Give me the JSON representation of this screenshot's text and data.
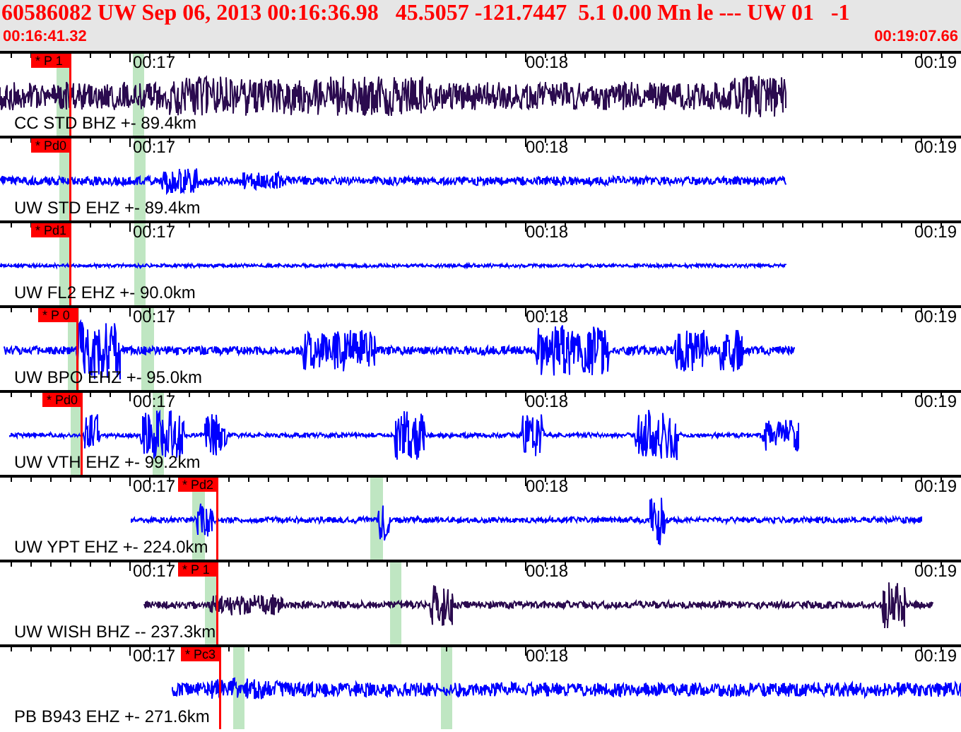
{
  "header": {
    "title": "60586082 UW Sep 06, 2013 00:16:36.98   45.5057 -121.7447  5.1 0.00 Mn le --- UW 01   -1",
    "start_time": "00:16:41.32",
    "end_time": "00:19:07.66"
  },
  "channels": [
    {
      "station": "CC STD BHZ +- 89.4km",
      "pick": "* P 1",
      "color": "#2b0b4f",
      "time_labels": [
        "00:17",
        "00:18",
        "00:19"
      ]
    },
    {
      "station": "UW STD EHZ +- 89.4km",
      "pick": "* Pd0",
      "color": "#0000ff",
      "time_labels": [
        "00:17",
        "00:18",
        "00:19"
      ]
    },
    {
      "station": "UW FL2 EHZ +- 90.0km",
      "pick": "* Pd1",
      "color": "#0000ff",
      "time_labels": [
        "00:17",
        "00:18",
        "00:19"
      ]
    },
    {
      "station": "UW BPO EHZ +- 95.0km",
      "pick": "* P 0",
      "color": "#0000ff",
      "time_labels": [
        "00:17",
        "00:18",
        "00:19"
      ]
    },
    {
      "station": "UW VTH EHZ +- 99.2km",
      "pick": "* Pd0",
      "color": "#0000ff",
      "time_labels": [
        "00:17",
        "00:18",
        "00:19"
      ]
    },
    {
      "station": "UW YPT EHZ +- 224.0km",
      "pick": "* Pd2",
      "color": "#0000ff",
      "time_labels": [
        "00:17",
        "00:18",
        "00:19"
      ]
    },
    {
      "station": "UW WISH BHZ -- 237.3km",
      "pick": "* P 1",
      "color": "#2b0b4f",
      "time_labels": [
        "00:17",
        "00:18",
        "00:19"
      ]
    },
    {
      "station": "PB B943 EHZ +- 271.6km",
      "pick": "* Pc3",
      "color": "#0000ff",
      "time_labels": [
        "00:17",
        "00:18",
        "00:19"
      ]
    }
  ]
}
